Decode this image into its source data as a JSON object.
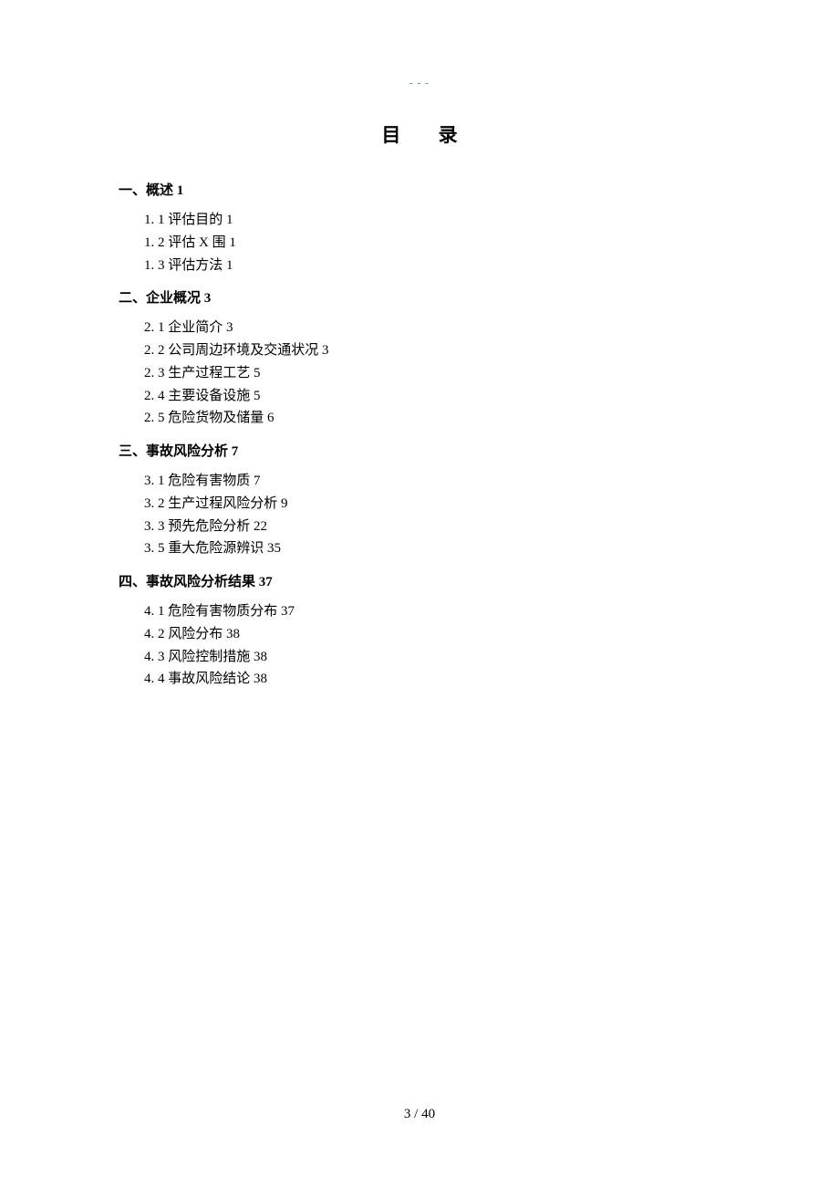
{
  "header_mark": "- - -",
  "title": "目 录",
  "sections": [
    {
      "heading": "一、概述 1",
      "items": [
        "1. 1 评估目的 1",
        "1. 2 评估 X 围 1",
        "1. 3 评估方法 1"
      ]
    },
    {
      "heading": "二、企业概况 3",
      "items": [
        "2. 1 企业简介 3",
        "2. 2 公司周边环境及交通状况 3",
        "2. 3 生产过程工艺 5",
        "2. 4 主要设备设施 5",
        "2. 5 危险货物及储量 6"
      ]
    },
    {
      "heading": "三、事故风险分析 7",
      "items": [
        "3. 1 危险有害物质 7",
        "3. 2 生产过程风险分析 9",
        "3. 3 预先危险分析 22",
        "3. 5 重大危险源辨识 35"
      ]
    },
    {
      "heading": "四、事故风险分析结果 37",
      "items": [
        "4. 1 危险有害物质分布 37",
        "4. 2 风险分布 38",
        "4. 3 风险控制措施 38",
        "4. 4 事故风险结论 38"
      ]
    }
  ],
  "footer": "3  / 40"
}
